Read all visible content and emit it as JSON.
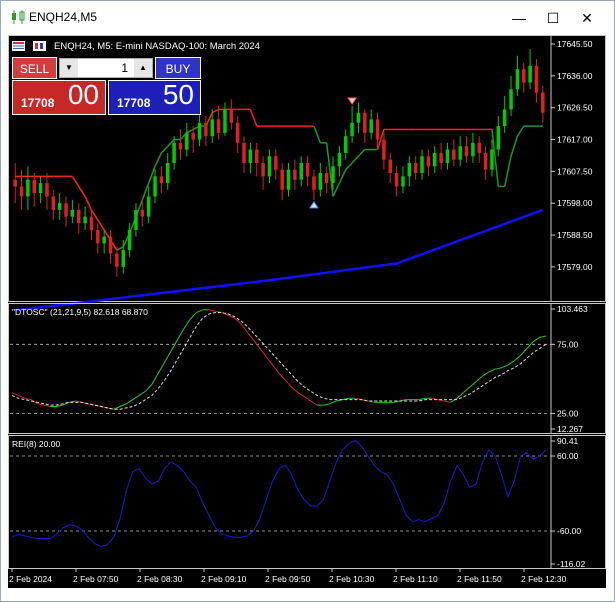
{
  "window": {
    "title": "ENQH24,M5",
    "minimize_glyph": "—",
    "maximize_glyph": "☐",
    "close_glyph": "✕"
  },
  "chart_header": {
    "symbol_text": "ENQH24, M5:  E-mini NASDAQ-100: March 2024"
  },
  "trade_panel": {
    "sell_label": "SELL",
    "buy_label": "BUY",
    "lot_value": "1",
    "sell_price_small": "17708",
    "sell_price_big": "00",
    "buy_price_small": "17708",
    "buy_price_big": "50",
    "sell_color": "#c62828",
    "buy_color": "#1c1fb8"
  },
  "colors": {
    "background": "#000000",
    "bull_candle": "#00cc00",
    "bear_candle": "#e02020",
    "stop_red": "#ff2020",
    "stop_green": "#1f9a1f",
    "ma_blue": "#1010ff",
    "rei_line": "#1a1acc",
    "axis_text": "#ffffff"
  },
  "chart_data": [
    {
      "type": "candlestick",
      "panel": "price",
      "y_ticks": [
        "17645.50",
        "17636.00",
        "17626.50",
        "17617.00",
        "17607.50",
        "17598.00",
        "17588.50",
        "17579.00"
      ],
      "ylim": [
        17570,
        17647
      ],
      "candles": [
        [
          17605,
          17603,
          17610,
          17598
        ],
        [
          17603,
          17600,
          17608,
          17596
        ],
        [
          17600,
          17605,
          17609,
          17596
        ],
        [
          17605,
          17601,
          17607,
          17597
        ],
        [
          17601,
          17604,
          17606,
          17598
        ],
        [
          17604,
          17600,
          17607,
          17596
        ],
        [
          17600,
          17596,
          17602,
          17593
        ],
        [
          17596,
          17598,
          17601,
          17593
        ],
        [
          17598,
          17594,
          17600,
          17591
        ],
        [
          17594,
          17596,
          17599,
          17592
        ],
        [
          17596,
          17592,
          17598,
          17589
        ],
        [
          17592,
          17594,
          17597,
          17590
        ],
        [
          17594,
          17590,
          17596,
          17587
        ],
        [
          17590,
          17586,
          17592,
          17583
        ],
        [
          17586,
          17588,
          17590,
          17583
        ],
        [
          17588,
          17583,
          17590,
          17580
        ],
        [
          17583,
          17579,
          17585,
          17576
        ],
        [
          17579,
          17584,
          17587,
          17577
        ],
        [
          17584,
          17590,
          17592,
          17582
        ],
        [
          17590,
          17596,
          17598,
          17588
        ],
        [
          17596,
          17594,
          17599,
          17591
        ],
        [
          17594,
          17600,
          17603,
          17592
        ],
        [
          17600,
          17606,
          17608,
          17598
        ],
        [
          17606,
          17604,
          17609,
          17601
        ],
        [
          17604,
          17610,
          17613,
          17602
        ],
        [
          17610,
          17616,
          17618,
          17608
        ],
        [
          17616,
          17614,
          17620,
          17611
        ],
        [
          17614,
          17619,
          17622,
          17612
        ],
        [
          17619,
          17617,
          17621,
          17613
        ],
        [
          17617,
          17622,
          17625,
          17615
        ],
        [
          17622,
          17618,
          17624,
          17615
        ],
        [
          17618,
          17623,
          17626,
          17616
        ],
        [
          17623,
          17619,
          17627,
          17617
        ],
        [
          17619,
          17626,
          17628,
          17618
        ],
        [
          17626,
          17622,
          17629,
          17620
        ],
        [
          17622,
          17616,
          17624,
          17613
        ],
        [
          17616,
          17610,
          17618,
          17607
        ],
        [
          17610,
          17614,
          17616,
          17607
        ],
        [
          17614,
          17610,
          17616,
          17606
        ],
        [
          17610,
          17606,
          17612,
          17602
        ],
        [
          17606,
          17612,
          17614,
          17604
        ],
        [
          17612,
          17608,
          17614,
          17605
        ],
        [
          17608,
          17602,
          17610,
          17599
        ],
        [
          17602,
          17608,
          17610,
          17600
        ],
        [
          17608,
          17605,
          17611,
          17602
        ],
        [
          17605,
          17610,
          17612,
          17603
        ],
        [
          17610,
          17606,
          17612,
          17603
        ],
        [
          17606,
          17602,
          17608,
          17599
        ],
        [
          17602,
          17607,
          17610,
          17600
        ],
        [
          17607,
          17604,
          17609,
          17601
        ],
        [
          17604,
          17609,
          17612,
          17602
        ],
        [
          17609,
          17613,
          17615,
          17606
        ],
        [
          17613,
          17618,
          17620,
          17611
        ],
        [
          17618,
          17622,
          17627,
          17616
        ],
        [
          17622,
          17625,
          17628,
          17619
        ],
        [
          17625,
          17619,
          17626,
          17616
        ],
        [
          17619,
          17623,
          17626,
          17617
        ],
        [
          17623,
          17617,
          17625,
          17614
        ],
        [
          17617,
          17611,
          17619,
          17608
        ],
        [
          17611,
          17607,
          17613,
          17604
        ],
        [
          17607,
          17603,
          17609,
          17600
        ],
        [
          17603,
          17606,
          17609,
          17601
        ],
        [
          17606,
          17610,
          17612,
          17603
        ],
        [
          17610,
          17607,
          17612,
          17605
        ],
        [
          17607,
          17612,
          17614,
          17605
        ],
        [
          17612,
          17609,
          17614,
          17606
        ],
        [
          17609,
          17613,
          17615,
          17607
        ],
        [
          17613,
          17610,
          17616,
          17608
        ],
        [
          17610,
          17614,
          17616,
          17608
        ],
        [
          17614,
          17611,
          17617,
          17609
        ],
        [
          17611,
          17615,
          17618,
          17609
        ],
        [
          17615,
          17612,
          17618,
          17610
        ],
        [
          17612,
          17616,
          17619,
          17610
        ],
        [
          17616,
          17613,
          17618,
          17610
        ],
        [
          17613,
          17608,
          17615,
          17605
        ],
        [
          17608,
          17614,
          17617,
          17606
        ],
        [
          17614,
          17621,
          17624,
          17612
        ],
        [
          17621,
          17626,
          17630,
          17619
        ],
        [
          17626,
          17632,
          17636,
          17624
        ],
        [
          17632,
          17638,
          17642,
          17630
        ],
        [
          17638,
          17634,
          17640,
          17631
        ],
        [
          17634,
          17639,
          17644,
          17632
        ],
        [
          17639,
          17631,
          17641,
          17628
        ],
        [
          17631,
          17625,
          17633,
          17622
        ]
      ],
      "stop_line_levels": [
        17606,
        17606,
        17606,
        17606,
        17606,
        17606,
        17606,
        17606,
        17606,
        17606,
        17603,
        17600,
        17596,
        17593,
        17590,
        17587,
        17584,
        17585,
        17589,
        17594,
        17599,
        17604,
        17609,
        17613,
        17615,
        17617,
        17617,
        17619,
        17620,
        17621,
        17621,
        17625,
        17626,
        17626,
        17626,
        17626,
        17626,
        17626,
        17621,
        17621,
        17621,
        17621,
        17621,
        17621,
        17621,
        17621,
        17621,
        17621,
        17616,
        17616,
        17600,
        17604,
        17608,
        17610,
        17612,
        17614,
        17614,
        17614,
        17620,
        17620,
        17620,
        17620,
        17620,
        17620,
        17620,
        17620,
        17620,
        17620,
        17620,
        17620,
        17620,
        17620,
        17620,
        17620,
        17620,
        17620,
        17603,
        17603,
        17612,
        17618,
        17621,
        17621,
        17621,
        17621
      ],
      "stop_line_state": [
        "red",
        "red",
        "red",
        "red",
        "red",
        "red",
        "red",
        "red",
        "red",
        "red",
        "red",
        "red",
        "red",
        "red",
        "red",
        "red",
        "red",
        "green",
        "green",
        "green",
        "green",
        "green",
        "green",
        "green",
        "green",
        "green",
        "green",
        "green",
        "green",
        "green",
        "green",
        "red",
        "red",
        "red",
        "red",
        "red",
        "red",
        "red",
        "red",
        "red",
        "red",
        "red",
        "red",
        "red",
        "red",
        "red",
        "red",
        "red",
        "green",
        "green",
        "green",
        "green",
        "green",
        "green",
        "green",
        "green",
        "green",
        "green",
        "red",
        "red",
        "red",
        "red",
        "red",
        "red",
        "red",
        "red",
        "red",
        "red",
        "red",
        "red",
        "red",
        "red",
        "red",
        "red",
        "red",
        "red",
        "green",
        "green",
        "green",
        "green",
        "green",
        "green",
        "green",
        "green"
      ],
      "ma_line": [
        [
          0,
          17566
        ],
        [
          40,
          17575
        ],
        [
          60,
          17580
        ],
        [
          83,
          17596
        ]
      ],
      "markers": [
        {
          "index": 53,
          "type": "down"
        },
        {
          "index": 47,
          "type": "up"
        }
      ]
    },
    {
      "type": "line",
      "panel": "oscillator",
      "title": "\"DTOSC\" (21,21,9,5) 82.618 68.870",
      "y_ticks": [
        "103.463",
        "75.00",
        "25.00",
        "12.267"
      ],
      "ylim": [
        12.267,
        103.463
      ],
      "levels": [
        75,
        25
      ],
      "series": [
        {
          "values": [
            40,
            38,
            36,
            35,
            32,
            31,
            30,
            30,
            31,
            33,
            34,
            33,
            32,
            31,
            30,
            29,
            28,
            30,
            32,
            35,
            38,
            41,
            46,
            54,
            62,
            70,
            78,
            86,
            93,
            98,
            100,
            100,
            99,
            98,
            96,
            94,
            90,
            84,
            78,
            72,
            66,
            60,
            54,
            49,
            44,
            40,
            37,
            34,
            31,
            31,
            32,
            34,
            35,
            36,
            36,
            35,
            34,
            33,
            33,
            33,
            33,
            34,
            35,
            35,
            35,
            36,
            36,
            35,
            34,
            33,
            36,
            40,
            44,
            48,
            52,
            55,
            57,
            58,
            60,
            63,
            67,
            72,
            77,
            80,
            81
          ]
        },
        {
          "values": [
            38,
            36,
            35,
            34,
            33,
            32,
            31,
            31,
            32,
            33,
            33,
            33,
            32,
            31,
            30,
            29,
            28,
            28,
            29,
            30,
            32,
            35,
            38,
            43,
            49,
            56,
            64,
            72,
            80,
            88,
            94,
            97,
            98,
            98,
            97,
            95,
            92,
            88,
            83,
            78,
            73,
            68,
            63,
            58,
            53,
            48,
            44,
            41,
            38,
            36,
            35,
            35,
            35,
            35,
            35,
            35,
            34,
            34,
            34,
            34,
            34,
            34,
            34,
            34,
            34,
            35,
            35,
            35,
            35,
            35,
            35,
            37,
            39,
            42,
            45,
            48,
            51,
            53,
            56,
            58,
            61,
            65,
            69,
            72,
            75
          ]
        }
      ]
    },
    {
      "type": "line",
      "panel": "rei",
      "title": "REI(8) 20.00",
      "y_ticks": [
        "90.41",
        "60.00",
        "-60.00",
        "-116.02"
      ],
      "ylim": [
        -116.02,
        90.41
      ],
      "levels": [
        60,
        -60
      ],
      "series": [
        {
          "values": [
            -70,
            -65,
            -68,
            -70,
            -72,
            -72,
            -72,
            -65,
            -55,
            -50,
            -52,
            -58,
            -70,
            -80,
            -85,
            -82,
            -70,
            -40,
            5,
            35,
            40,
            25,
            15,
            20,
            40,
            50,
            45,
            35,
            20,
            10,
            -15,
            -35,
            -55,
            -65,
            -68,
            -70,
            -70,
            -68,
            -60,
            -40,
            -10,
            20,
            40,
            45,
            30,
            5,
            -10,
            -20,
            -20,
            -10,
            20,
            50,
            70,
            80,
            85,
            75,
            60,
            45,
            35,
            30,
            15,
            -10,
            -35,
            -45,
            -42,
            -45,
            -40,
            -35,
            -15,
            20,
            45,
            30,
            10,
            15,
            50,
            70,
            60,
            30,
            -5,
            20,
            60,
            65,
            55,
            60,
            70
          ]
        }
      ]
    }
  ],
  "x_axis": {
    "tick_labels": [
      "2 Feb 2024",
      "2 Feb 07:50",
      "2 Feb 08:30",
      "2 Feb 09:10",
      "2 Feb 09:50",
      "2 Feb 10:30",
      "2 Feb 11:10",
      "2 Feb 11:50",
      "2 Feb 12:30"
    ]
  }
}
